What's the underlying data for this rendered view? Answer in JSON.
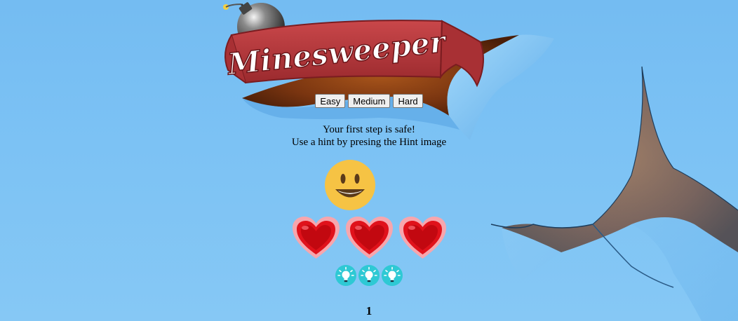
{
  "app": {
    "logo_text": "Minesweeper"
  },
  "difficulty": {
    "easy_label": "Easy",
    "medium_label": "Medium",
    "hard_label": "Hard"
  },
  "message": {
    "line1": "Your first step is safe!",
    "line2": "Use a hint by presing the Hint image"
  },
  "status": {
    "face_icon": "smiley-face-icon",
    "lives_count": 3,
    "lives_icon": "heart-icon",
    "hints_count": 3,
    "hints_icon": "lightbulb-icon",
    "counter": "1"
  },
  "colors": {
    "background": "#7cc2f4",
    "banner": "#b8373b",
    "heart": "#e0121b",
    "hint_circle": "#2ec9d4",
    "smiley": "#f6c344"
  }
}
